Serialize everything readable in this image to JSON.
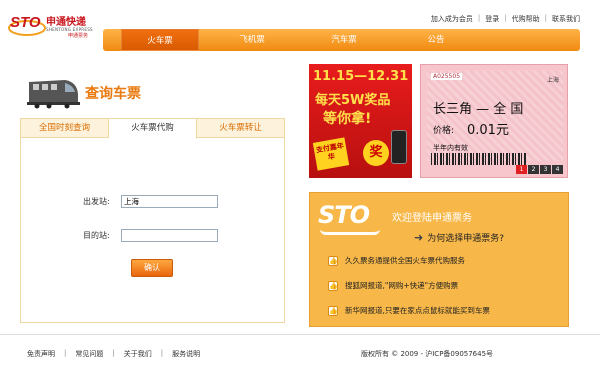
{
  "brand": {
    "name_cn": "申通快递",
    "name_en": "SHENTONG EXPRESS",
    "sub": "申通票务",
    "mark": "STO"
  },
  "top_links": [
    "加入成为会员",
    "登录",
    "代购帮助",
    "联系我们"
  ],
  "nav": [
    {
      "label": "火车票",
      "active": true
    },
    {
      "label": "飞机票",
      "active": false
    },
    {
      "label": "汽车票",
      "active": false
    },
    {
      "label": "公告",
      "active": false
    }
  ],
  "query": {
    "title": "查询车票"
  },
  "tabs": [
    {
      "label": "全国时刻查询",
      "active": false
    },
    {
      "label": "火车票代购",
      "active": true
    },
    {
      "label": "火车票转让",
      "active": false
    }
  ],
  "form": {
    "from_label": "出发站:",
    "from_value": "上海",
    "to_label": "目的站:",
    "to_value": "",
    "submit": "确认"
  },
  "promo": {
    "date": "11.15—12.31",
    "line1": "每天5W奖品",
    "line2": "等你拿!",
    "badge": "支付嘉年华",
    "jiang": "奖"
  },
  "ticket": {
    "number": "A025505",
    "corner": "上海",
    "route": "长三角 — 全 国",
    "price_label": "价格:",
    "price": "0.01元",
    "valid": "半年内有效",
    "pages": [
      "1",
      "2",
      "3",
      "4"
    ]
  },
  "login": {
    "logo": "STO",
    "welcome": "欢迎登陆申通票务",
    "why": "为何选择申通票务?",
    "features": [
      "久久票务通提供全国火车票代购服务",
      "搜狐网报道,\"网购+快递\"方便购票",
      "新华网报道,只要在家点点鼠标就能买到车票"
    ]
  },
  "footer": {
    "links": [
      "免责声明",
      "常见问题",
      "关于我们",
      "服务说明"
    ],
    "copyright": "版权所有 © 2009 - 沪ICP备09057645号"
  },
  "colors": {
    "accent": "#f08a10",
    "brand_red": "#c8161d",
    "login_bg": "#f8b849"
  }
}
